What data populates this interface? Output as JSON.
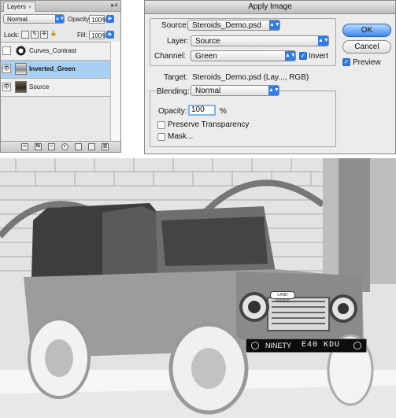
{
  "layers_panel": {
    "tab_label": "Layers",
    "tab_close": "×",
    "menu_icon": "panel-menu-icon",
    "blend_mode": "Normal",
    "opacity_label": "Opacity:",
    "opacity_value": "100%",
    "lock_label": "Lock:",
    "fill_label": "Fill:",
    "fill_value": "100%",
    "layers": [
      {
        "name": "Curves_Contrast",
        "visible": false,
        "active": false
      },
      {
        "name": "Inverted_Green",
        "visible": true,
        "active": true
      },
      {
        "name": "Source",
        "visible": true,
        "active": false
      }
    ],
    "bottom_icons": [
      "link-icon",
      "fx-icon",
      "mask-icon",
      "adjustment-icon",
      "folder-icon",
      "new-layer-icon",
      "trash-icon"
    ]
  },
  "apply_image": {
    "title": "Apply Image",
    "source_label": "Source:",
    "source_value": "Steroids_Demo.psd",
    "layer_label": "Layer:",
    "layer_value": "Source",
    "channel_label": "Channel:",
    "channel_value": "Green",
    "invert_label": "Invert",
    "invert_checked": true,
    "target_label": "Target:",
    "target_value": "Steroids_Demo.psd (Lay..., RGB)",
    "blending_label": "Blending:",
    "blending_value": "Normal",
    "opacity_label": "Opacity:",
    "opacity_value": "100",
    "opacity_unit": "%",
    "preserve_label": "Preserve Transparency",
    "mask_label": "Mask...",
    "ok_label": "OK",
    "cancel_label": "Cancel",
    "preview_label": "Preview",
    "preview_checked": true
  },
  "photo": {
    "plate_left": "NINETY",
    "plate_main": "E40 KDU",
    "badge_text": "LAND ROVER"
  }
}
